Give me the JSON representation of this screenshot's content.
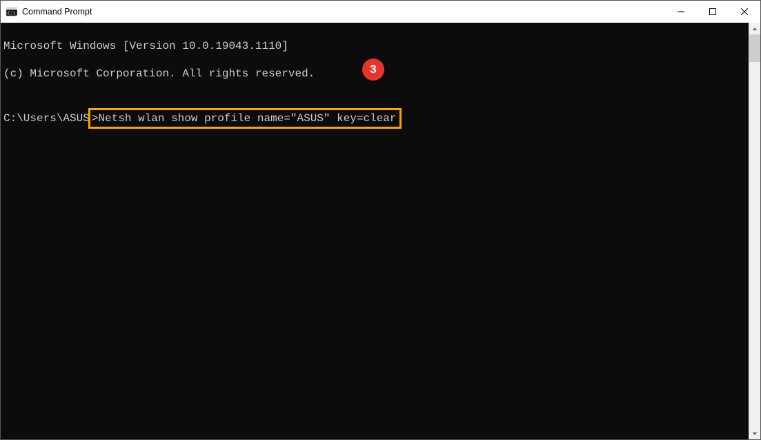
{
  "window": {
    "title": "Command Prompt"
  },
  "terminal": {
    "line1": "Microsoft Windows [Version 10.0.19043.1110]",
    "line2": "(c) Microsoft Corporation. All rights reserved.",
    "blank": "",
    "prompt_prefix": "C:\\Users\\ASUS",
    "prompt_gt": ">",
    "command": "Netsh wlan show profile name=\"ASUS\" key=clear"
  },
  "callout": {
    "number": "3"
  },
  "scrollbar": {
    "up": "▲",
    "down": "▼"
  },
  "win_controls": {
    "minimize": "—",
    "maximize": "□",
    "close": "✕"
  }
}
